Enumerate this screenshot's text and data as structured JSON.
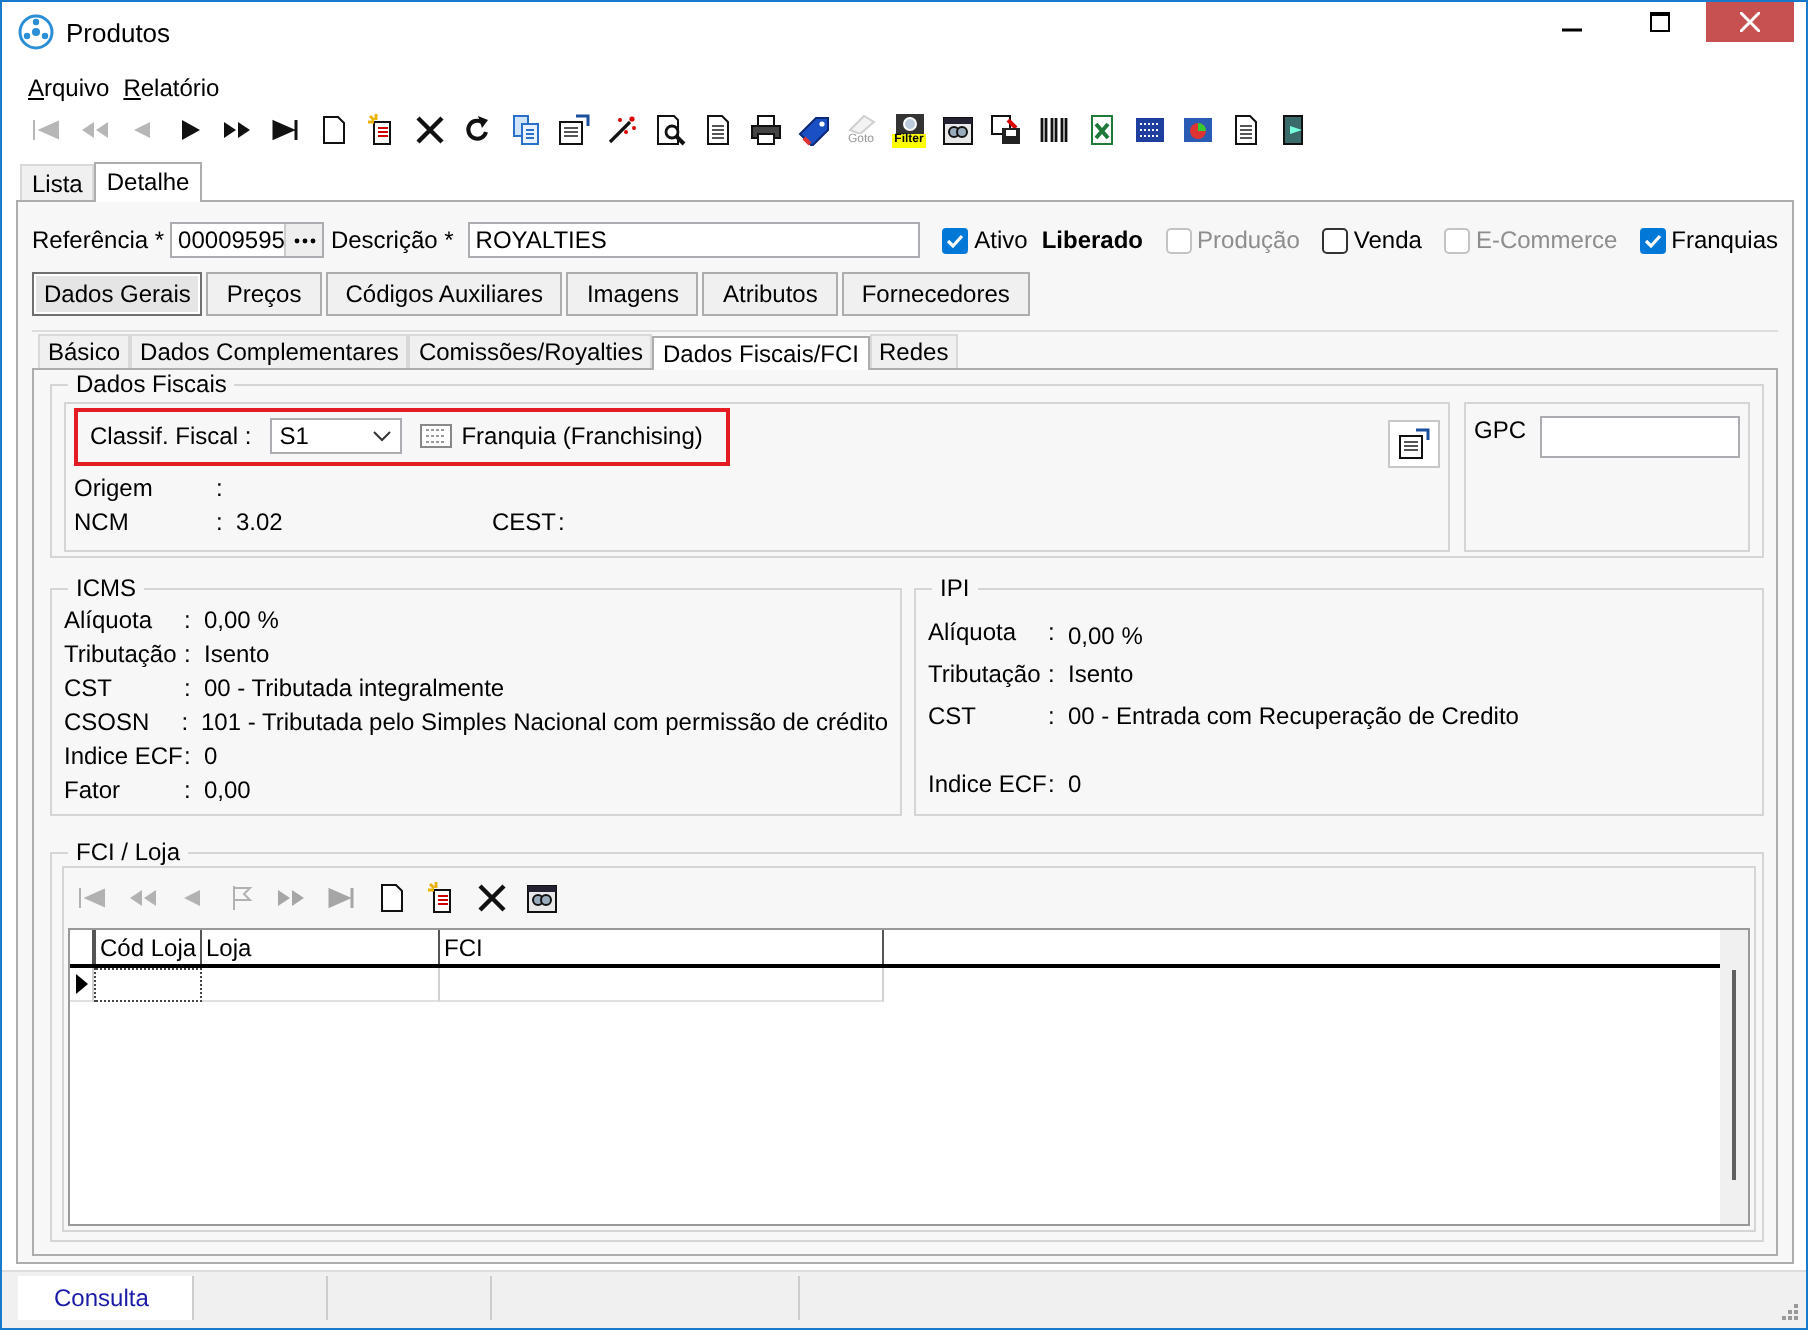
{
  "window": {
    "title": "Produtos"
  },
  "menu": [
    {
      "label": "Arquivo"
    },
    {
      "label": "Relatório"
    }
  ],
  "toolbar": [
    {
      "kind": "first",
      "disabled": true
    },
    {
      "kind": "prev-page",
      "disabled": true
    },
    {
      "kind": "prev",
      "disabled": true
    },
    {
      "kind": "next",
      "disabled": false
    },
    {
      "kind": "next-page",
      "disabled": false
    },
    {
      "kind": "last",
      "disabled": false
    },
    {
      "kind": "page",
      "disabled": false
    },
    {
      "kind": "edit-page",
      "disabled": false
    },
    {
      "kind": "cross",
      "disabled": false
    },
    {
      "kind": "refresh",
      "disabled": false
    },
    {
      "kind": "copy",
      "disabled": false
    },
    {
      "kind": "window",
      "disabled": false
    },
    {
      "kind": "wand",
      "disabled": false
    },
    {
      "kind": "magnifier-page",
      "disabled": false
    },
    {
      "kind": "page-lines",
      "disabled": false
    },
    {
      "kind": "printer",
      "disabled": false
    },
    {
      "kind": "tag",
      "disabled": false
    },
    {
      "kind": "goto",
      "disabled": true,
      "label": "Goto"
    },
    {
      "kind": "filter",
      "disabled": false,
      "label": "Filter"
    },
    {
      "kind": "binoculars",
      "disabled": false
    },
    {
      "kind": "save",
      "disabled": false
    },
    {
      "kind": "barcode",
      "disabled": false
    },
    {
      "kind": "excel",
      "disabled": false
    },
    {
      "kind": "calculator",
      "disabled": false
    },
    {
      "kind": "pie",
      "disabled": false
    },
    {
      "kind": "page-lines",
      "disabled": false
    },
    {
      "kind": "exit",
      "disabled": false
    }
  ],
  "view_tabs": [
    {
      "label": "Lista",
      "selected": false
    },
    {
      "label": "Detalhe",
      "selected": true
    }
  ],
  "header": {
    "reference": {
      "label": "Referência *",
      "value": "00009595"
    },
    "description": {
      "label": "Descrição *",
      "value": "ROYALTIES"
    },
    "status": "Liberado",
    "checks": [
      {
        "label": "Ativo",
        "checked": true,
        "disabled": false,
        "status_after": true
      },
      {
        "label": "Produção",
        "checked": false,
        "disabled": true
      },
      {
        "label": "Venda",
        "checked": false,
        "disabled": false
      },
      {
        "label": "E-Commerce",
        "checked": false,
        "disabled": true
      },
      {
        "label": "Franquias",
        "checked": true,
        "disabled": false
      }
    ]
  },
  "main_tabs": [
    {
      "label": "Dados Gerais",
      "selected": true
    },
    {
      "label": "Preços",
      "selected": false
    },
    {
      "label": "Códigos Auxiliares",
      "selected": false
    },
    {
      "label": "Imagens",
      "selected": false
    },
    {
      "label": "Atributos",
      "selected": false
    },
    {
      "label": "Fornecedores",
      "selected": false
    }
  ],
  "sub_tabs": [
    {
      "label": "Básico",
      "selected": false
    },
    {
      "label": "Dados Complementares",
      "selected": false
    },
    {
      "label": "Comissões/Royalties",
      "selected": false
    },
    {
      "label": "Dados Fiscais/FCI",
      "selected": true
    },
    {
      "label": "Redes",
      "selected": false
    }
  ],
  "dados_fiscais": {
    "title": "Dados Fiscais",
    "classif_label": "Classif. Fiscal :",
    "classif_value": "S1",
    "classif_description": "Franquia (Franchising)",
    "highlighted": true,
    "origem": {
      "label": "Origem",
      "sep": ":"
    },
    "ncm": {
      "label": "NCM",
      "sep": ":",
      "value": "3.02"
    },
    "cest": {
      "label": "CEST",
      "sep": ":"
    },
    "gpc_label": "GPC"
  },
  "tax_groups": [
    {
      "title": "ICMS",
      "rows": [
        {
          "label": "Alíquota",
          "sep": ":",
          "value": "0,00 %"
        },
        {
          "label": "Tributação",
          "sep": ":",
          "value": "Isento"
        },
        {
          "label": "CST",
          "sep": ":",
          "value": "00 - Tributada integralmente"
        },
        {
          "label": "CSOSN",
          "sep": ":",
          "value": "101 - Tributada pelo Simples Nacional com permissão de crédito"
        },
        {
          "label": "Indice ECF",
          "sep": ":",
          "value": "0"
        },
        {
          "label": "Fator",
          "sep": ":",
          "value": "0,00"
        }
      ]
    },
    {
      "title": "IPI",
      "rows": [
        {
          "label": "Alíquota",
          "sep": ":",
          "value": "0,00 %"
        },
        {
          "label": "Tributação",
          "sep": ":",
          "value": "Isento"
        },
        {
          "label": "CST",
          "sep": ":",
          "value": "00 - Entrada com Recuperação de Credito"
        },
        {
          "label": "Indice ECF",
          "sep": ":",
          "value": "0"
        }
      ]
    }
  ],
  "fci": {
    "title": "FCI / Loja",
    "toolbar": [
      {
        "kind": "first",
        "disabled": true
      },
      {
        "kind": "prev-page",
        "disabled": true
      },
      {
        "kind": "prev",
        "disabled": true
      },
      {
        "kind": "next-flag",
        "disabled": true
      },
      {
        "kind": "next-page",
        "disabled": true
      },
      {
        "kind": "last",
        "disabled": true
      },
      {
        "kind": "page",
        "disabled": false
      },
      {
        "kind": "edit-page",
        "disabled": false
      },
      {
        "kind": "cross",
        "disabled": false
      },
      {
        "kind": "binoculars",
        "disabled": false
      }
    ],
    "columns": [
      "Cód Loja",
      "Loja",
      "FCI"
    ]
  },
  "status_bar": [
    {
      "text": "Consulta"
    }
  ]
}
